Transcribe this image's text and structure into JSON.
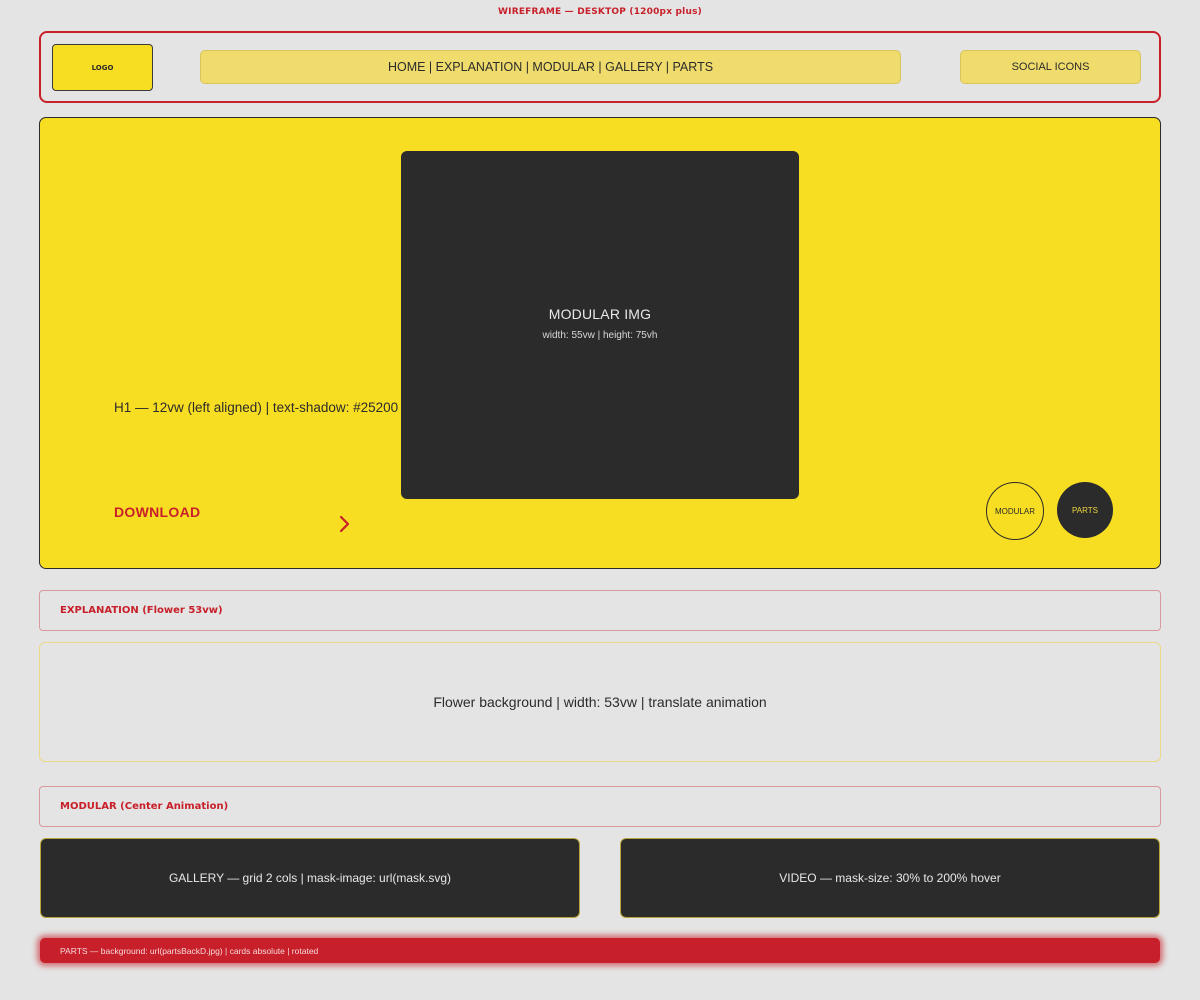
{
  "page_title": "WIREFRAME — DESKTOP (1200px plus)",
  "header": {
    "logo": "LOGO",
    "nav": "HOME | EXPLANATION | MODULAR | GALLERY | PARTS",
    "social": "SOCIAL ICONS"
  },
  "hero": {
    "h1_note": "H1 — 12vw (left aligned) | text-shadow: #25200",
    "image_title": "MODULAR IMG",
    "image_sub": "width: 55vw | height: 75vh",
    "download": "DOWNLOAD",
    "circle_modular": "MODULAR",
    "circle_parts": "PARTS"
  },
  "explanation": {
    "heading": "EXPLANATION (Flower 53vw)",
    "flower_text": "Flower background | width: 53vw | translate animation"
  },
  "modular": {
    "heading": "MODULAR (Center Animation)"
  },
  "gallery": {
    "text": "GALLERY — grid 2 cols | mask-image: url(mask.svg)"
  },
  "video": {
    "text": "VIDEO — mask-size: 30% to 200% hover"
  },
  "parts": {
    "text": "PARTS — background: url(partsBackD.jpg) | cards absolute | rotated"
  },
  "colors": {
    "background": "#e4e4e4",
    "yellow": "#f8de22",
    "red": "#c8202a",
    "dark": "#2b2b2b"
  }
}
